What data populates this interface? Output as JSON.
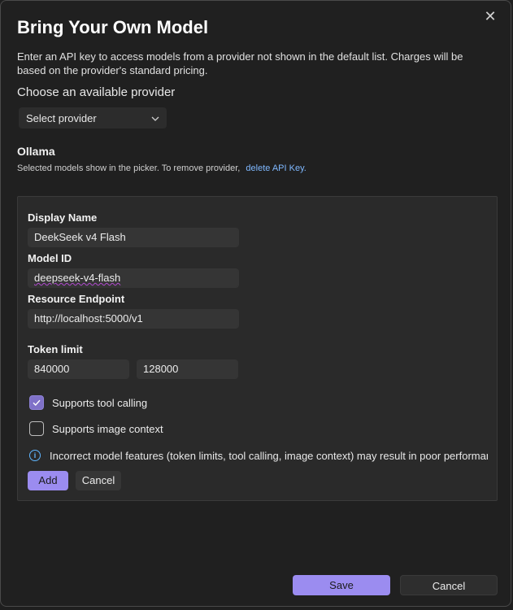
{
  "dialog": {
    "title": "Bring Your Own Model",
    "close_glyph": "✕",
    "description": "Enter an API key to access models from a provider not shown in the default list. Charges will be based on the provider's standard pricing.",
    "choose_label": "Choose an available provider",
    "provider_select": {
      "value": "Select provider",
      "chevron": "⌄"
    }
  },
  "provider": {
    "name": "Ollama",
    "note": "Selected models show in the picker. To remove provider,",
    "delete_link": "delete API Key."
  },
  "form": {
    "display_name_label": "Display Name",
    "display_name_value": "DeekSeek v4 Flash",
    "model_id_label": "Model ID",
    "model_id_value": "deepseek-v4-flash",
    "endpoint_label": "Resource Endpoint",
    "endpoint_value": "http://localhost:5000/v1",
    "token_limit_label": "Token limit",
    "token_limit_input": "840000",
    "token_limit_output": "128000",
    "tool_calling_label": "Supports tool calling",
    "tool_calling_checked": true,
    "image_context_label": "Supports image context",
    "image_context_checked": false,
    "info_glyph": "i",
    "info_text": "Incorrect model features (token limits, tool calling, image context) may result in poor performance.",
    "add_label": "Add",
    "cancel_label": "Cancel"
  },
  "footer": {
    "save_label": "Save",
    "cancel_label": "Cancel"
  },
  "colors": {
    "accent": "#9b8cf0",
    "link": "#7fb8ff",
    "info": "#5fb6ff",
    "background": "#202020"
  },
  "icons": {
    "close": "close-icon",
    "chevron": "chevron-down-icon",
    "check": "checkmark-icon",
    "info": "info-icon"
  }
}
